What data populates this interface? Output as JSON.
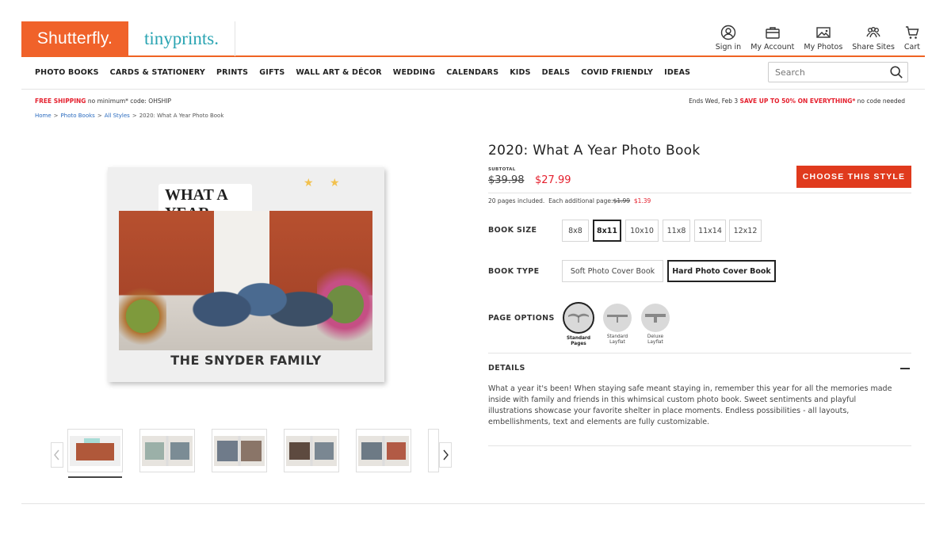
{
  "header": {
    "logo_primary": "Shutterfly.",
    "logo_secondary": "tinyprints.",
    "util_nav": [
      {
        "label": "Sign in",
        "icon": "user-icon"
      },
      {
        "label": "My Account",
        "icon": "briefcase-icon"
      },
      {
        "label": "My Photos",
        "icon": "photo-icon"
      },
      {
        "label": "Share Sites",
        "icon": "people-icon"
      },
      {
        "label": "Cart",
        "icon": "cart-icon"
      }
    ]
  },
  "nav": {
    "items": [
      "PHOTO BOOKS",
      "CARDS & STATIONERY",
      "PRINTS",
      "GIFTS",
      "WALL ART & DÉCOR",
      "WEDDING",
      "CALENDARS",
      "KIDS",
      "DEALS",
      "COVID FRIENDLY",
      "IDEAS"
    ],
    "search_placeholder": "Search"
  },
  "promo": {
    "left_highlight": "FREE SHIPPING",
    "left_rest": " no minimum* code: OHSHIP",
    "right_prefix": "Ends Wed, Feb 3 ",
    "right_highlight": "SAVE UP TO 50% ON EVERYTHING*",
    "right_suffix": " no code needed"
  },
  "breadcrumb": {
    "items": [
      "Home",
      "Photo Books",
      "All Styles"
    ],
    "current": "2020: What A Year Photo Book",
    "separator": ">"
  },
  "product": {
    "cover_badge": "WHAT A YEAR",
    "cover_family": "THE SNYDER FAMILY",
    "title": "2020: What A Year Photo Book",
    "subtotal_label": "SUBTOTAL",
    "price_original": "$39.98",
    "price_sale": "$27.99",
    "cta_label": "CHOOSE THIS STYLE",
    "pages_included": "20 pages included.",
    "each_additional": "Each additional page:",
    "additional_old": "$1.99",
    "additional_new": "$1.39",
    "book_size_label": "BOOK SIZE",
    "sizes": [
      "8x8",
      "8x11",
      "10x10",
      "11x8",
      "11x14",
      "12x12"
    ],
    "selected_size": "8x11",
    "book_type_label": "BOOK TYPE",
    "types": [
      "Soft Photo Cover Book",
      "Hard Photo Cover Book"
    ],
    "selected_type": "Hard Photo Cover Book",
    "page_options_label": "PAGE OPTIONS",
    "page_options": [
      {
        "line1": "Standard",
        "line2": "Pages"
      },
      {
        "line1": "Standard",
        "line2": "Layflat"
      },
      {
        "line1": "Deluxe",
        "line2": "Layflat"
      }
    ],
    "selected_page_option": "Standard Pages",
    "details_label": "DETAILS",
    "description": "What a year it's been! When staying safe meant staying in, remember this year for all the memories made inside with family and friends in this whimsical custom photo book. Sweet sentiments and playful illustrations showcase your favorite shelter in place moments. Endless possibilities - all layouts, embellishments, text and elements are fully customizable."
  },
  "colors": {
    "brand_orange": "#f0622a",
    "tinyprints_teal": "#2aa4b2",
    "cta_red": "#e03a1d",
    "sale_red": "#e5202e"
  }
}
